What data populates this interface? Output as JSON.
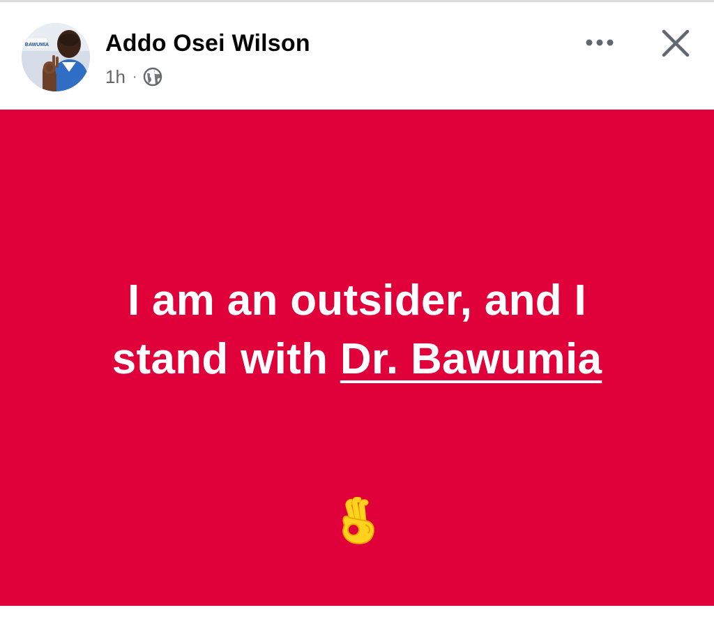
{
  "post": {
    "author_name": "Addo Osei Wilson",
    "timestamp": "1h",
    "audience_icon": "globe-icon",
    "separator": "·",
    "avatar_badge_text": "BAWUMIA",
    "menu_icon": "more-icon",
    "close_icon": "close-icon",
    "text_line_1": "I am an outsider, and I",
    "text_line_2_prefix": "stand with ",
    "mention": "Dr. Bawumia",
    "emoji": "ok-hand-emoji"
  },
  "colors": {
    "post_background": "#e0003a",
    "post_text": "#ffffff",
    "author_text": "#050505",
    "meta_text": "#65676b",
    "icon_color": "#606770",
    "border": "#d9dadd"
  }
}
